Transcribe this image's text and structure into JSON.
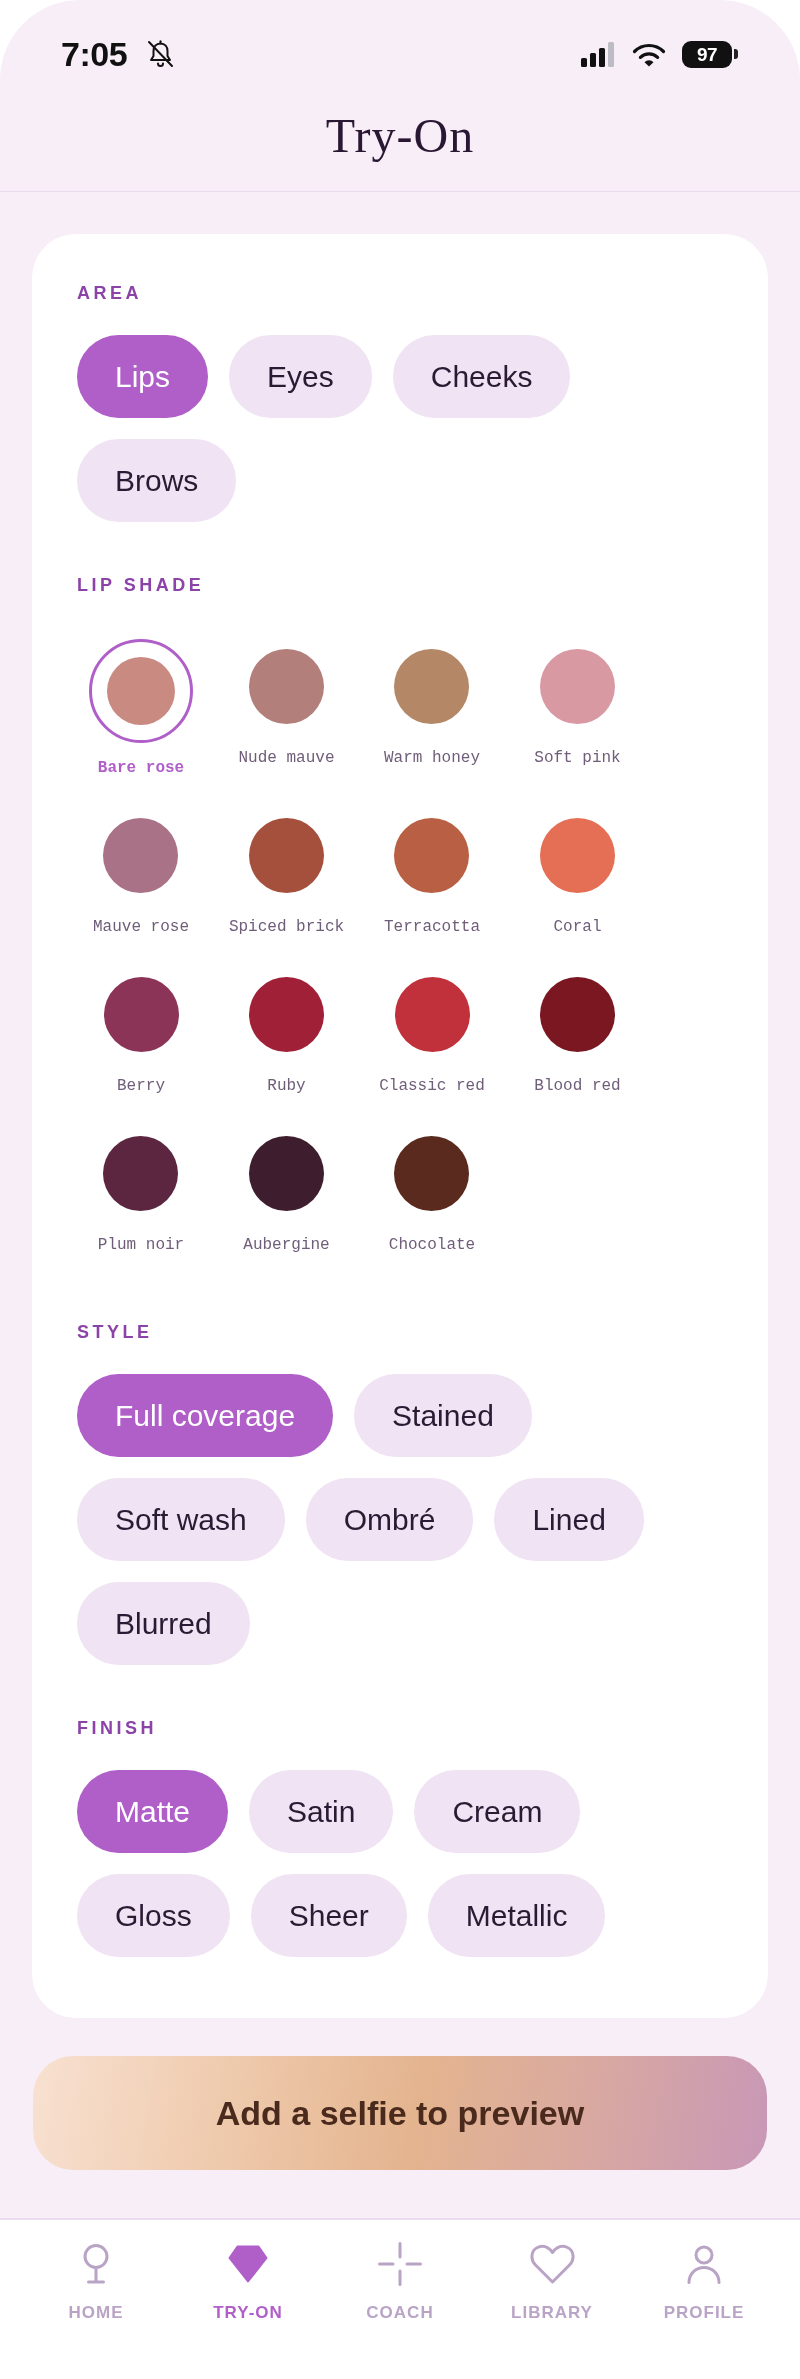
{
  "status_bar": {
    "time": "7:05",
    "battery": "97"
  },
  "header": {
    "title": "Try-On"
  },
  "sections": [
    {
      "kind": "chips",
      "label": "AREA",
      "options": [
        {
          "label": "Lips",
          "selected": true
        },
        {
          "label": "Eyes",
          "selected": false
        },
        {
          "label": "Cheeks",
          "selected": false
        },
        {
          "label": "Brows",
          "selected": false
        }
      ]
    },
    {
      "kind": "swatches",
      "label": "LIP SHADE",
      "shades": [
        {
          "name": "Bare rose",
          "color": "#c98a82",
          "selected": true
        },
        {
          "name": "Nude mauve",
          "color": "#b27f7a",
          "selected": false
        },
        {
          "name": "Warm honey",
          "color": "#b48767",
          "selected": false
        },
        {
          "name": "Soft pink",
          "color": "#d899a3",
          "selected": false
        },
        {
          "name": "Mauve rose",
          "color": "#a97286",
          "selected": false
        },
        {
          "name": "Spiced brick",
          "color": "#a5503c",
          "selected": false
        },
        {
          "name": "Terracotta",
          "color": "#b96044",
          "selected": false
        },
        {
          "name": "Coral",
          "color": "#e46f55",
          "selected": false
        },
        {
          "name": "Berry",
          "color": "#8c3457",
          "selected": false
        },
        {
          "name": "Ruby",
          "color": "#a02038",
          "selected": false
        },
        {
          "name": "Classic red",
          "color": "#c0313b",
          "selected": false
        },
        {
          "name": "Blood red",
          "color": "#7a1720",
          "selected": false
        },
        {
          "name": "Plum noir",
          "color": "#5c2640",
          "selected": false
        },
        {
          "name": "Aubergine",
          "color": "#3e1e2e",
          "selected": false
        },
        {
          "name": "Chocolate",
          "color": "#5a2a1e",
          "selected": false
        }
      ]
    },
    {
      "kind": "chips",
      "label": "STYLE",
      "options": [
        {
          "label": "Full coverage",
          "selected": true
        },
        {
          "label": "Stained",
          "selected": false
        },
        {
          "label": "Soft wash",
          "selected": false
        },
        {
          "label": "Ombré",
          "selected": false
        },
        {
          "label": "Lined",
          "selected": false
        },
        {
          "label": "Blurred",
          "selected": false
        }
      ]
    },
    {
      "kind": "chips",
      "label": "FINISH",
      "options": [
        {
          "label": "Matte",
          "selected": true
        },
        {
          "label": "Satin",
          "selected": false
        },
        {
          "label": "Cream",
          "selected": false
        },
        {
          "label": "Gloss",
          "selected": false
        },
        {
          "label": "Sheer",
          "selected": false
        },
        {
          "label": "Metallic",
          "selected": false
        }
      ]
    }
  ],
  "preview_button": {
    "label": "Add a selfie to preview"
  },
  "nav": [
    {
      "label": "HOME",
      "selected": false
    },
    {
      "label": "TRY-ON",
      "selected": true
    },
    {
      "label": "COACH",
      "selected": false
    },
    {
      "label": "LIBRARY",
      "selected": false
    },
    {
      "label": "PROFILE",
      "selected": false
    }
  ]
}
